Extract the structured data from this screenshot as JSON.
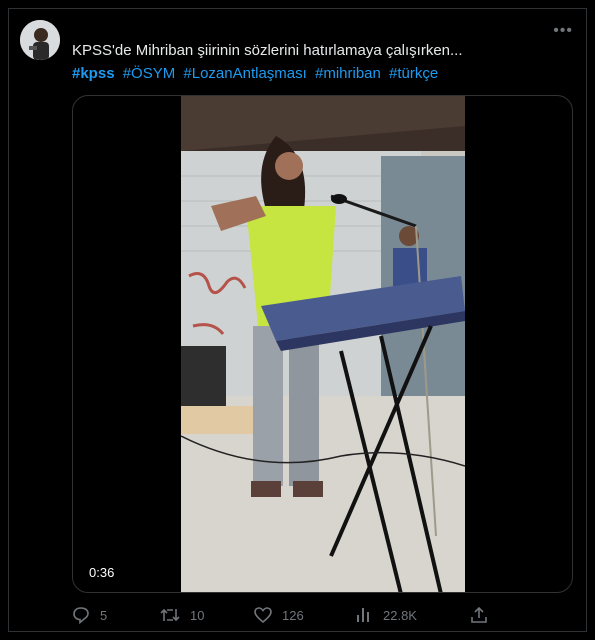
{
  "tweet": {
    "text": "KPSS'de Mihriban şiirinin sözlerini hatırlamaya çalışırken...",
    "hashtags": [
      "#kpss",
      "#ÖSYM",
      "#LozanAntlaşması",
      "#mihriban",
      "#türkçe"
    ]
  },
  "media": {
    "duration": "0:36"
  },
  "actions": {
    "replies": "5",
    "retweets": "10",
    "likes": "126",
    "views": "22.8K"
  },
  "icons": [
    "reply-icon",
    "retweet-icon",
    "like-icon",
    "views-icon",
    "share-icon",
    "more-icon"
  ],
  "colors": {
    "background": "#000000",
    "link": "#1d9bf0",
    "muted": "#71767b",
    "text": "#e7e9ea"
  }
}
